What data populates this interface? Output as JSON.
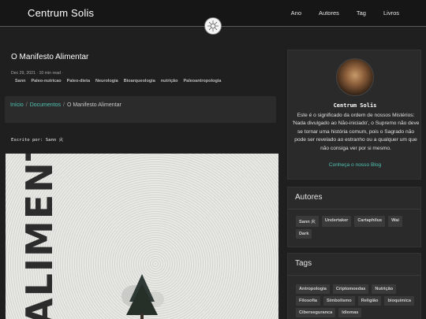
{
  "navbar": {
    "brand": "Centrum Solis",
    "links": [
      "Ano",
      "Autores",
      "Tag",
      "Livros"
    ]
  },
  "post": {
    "title": "O Manifesto Alimentar",
    "meta": "Dec 29, 2021 · 10 min read ·",
    "tags": [
      "Sann",
      "Paleo-nutricao",
      "Paleo-dieta",
      "Neurologia",
      "Bioarqueologia",
      "nutrição",
      "Paleoantropologia"
    ],
    "author_line": "Escrito por: Sann 火",
    "image_word": "ALIMENTAR"
  },
  "breadcrumb": {
    "items": [
      "Início",
      "Documentos",
      "O Manifesto Alimentar"
    ],
    "separator": "/"
  },
  "sidebar": {
    "about": {
      "name": "Centrum Solis",
      "text": "Este é o significado da ordem de nossos Mistérios: 'Nada divulgado ao Não-iniciado', o Supremo não deve se tornar uma história comum, pois o Sagrado não pode ser revelado ao estranho ou a qualquer um que não consiga ver por si mesmo.",
      "link": "Conheça o nosso Blog"
    },
    "authors": {
      "title": "Autores",
      "items": [
        "Sann 火",
        "Undertaker",
        "Cartaphilus",
        "Wai",
        "Dark"
      ]
    },
    "tags": {
      "title": "Tags",
      "items": [
        "Antropologia",
        "Criptomoedas",
        "Nutrição",
        "Filosofia",
        "Simbolismo",
        "Religião",
        "bioquímica",
        "Ciberseguranca",
        "Idiomas"
      ]
    }
  },
  "colors": {
    "accent": "#4fc3b4",
    "background": "#1f1f1f",
    "card": "#2a2a2a"
  },
  "icons": {
    "emblem": "sun-emblem-icon"
  }
}
